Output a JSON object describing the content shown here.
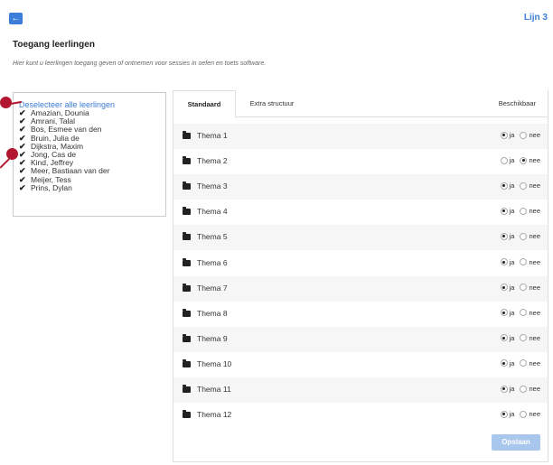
{
  "header": {
    "back_label": "←",
    "line_label": "Lijn 3"
  },
  "page": {
    "title": "Toegang leerlingen",
    "description": "Hier kunt u leerlingen toegang geven of ontnemen voor sessies in oefen en toets software."
  },
  "students": {
    "deselect_all_label": "Deselecteer alle leerlingen",
    "items": [
      {
        "name": "Amazian, Dounia",
        "checked": true
      },
      {
        "name": "Amrani, Talal",
        "checked": true
      },
      {
        "name": "Bos, Esmee van den",
        "checked": true
      },
      {
        "name": "Bruin, Julia de",
        "checked": true
      },
      {
        "name": "Dijkstra, Maxim",
        "checked": true
      },
      {
        "name": "Jong, Cas de",
        "checked": true
      },
      {
        "name": "Kind, Jeffrey",
        "checked": true
      },
      {
        "name": "Meer, Bastiaan van der",
        "checked": true
      },
      {
        "name": "Meijer, Tess",
        "checked": true
      },
      {
        "name": "Prins, Dylan",
        "checked": true
      }
    ]
  },
  "tabs": {
    "standard": "Standaard",
    "extra": "Extra structuur",
    "available": "Beschikbaar"
  },
  "options": {
    "yes": "ja",
    "no": "nee"
  },
  "themes": [
    {
      "label": "Thema 1",
      "selected": "ja"
    },
    {
      "label": "Thema 2",
      "selected": "nee"
    },
    {
      "label": "Thema 3",
      "selected": "ja"
    },
    {
      "label": "Thema 4",
      "selected": "ja"
    },
    {
      "label": "Thema 5",
      "selected": "ja"
    },
    {
      "label": "Thema 6",
      "selected": "ja"
    },
    {
      "label": "Thema 7",
      "selected": "ja"
    },
    {
      "label": "Thema 8",
      "selected": "ja"
    },
    {
      "label": "Thema 9",
      "selected": "ja"
    },
    {
      "label": "Thema 10",
      "selected": "ja"
    },
    {
      "label": "Thema 11",
      "selected": "ja"
    },
    {
      "label": "Thema 12",
      "selected": "ja"
    }
  ],
  "actions": {
    "save_label": "Opslaan"
  },
  "colors": {
    "accent": "#3b7dd8",
    "hotspot": "#b3172f",
    "save_disabled": "#a9c7ec"
  }
}
